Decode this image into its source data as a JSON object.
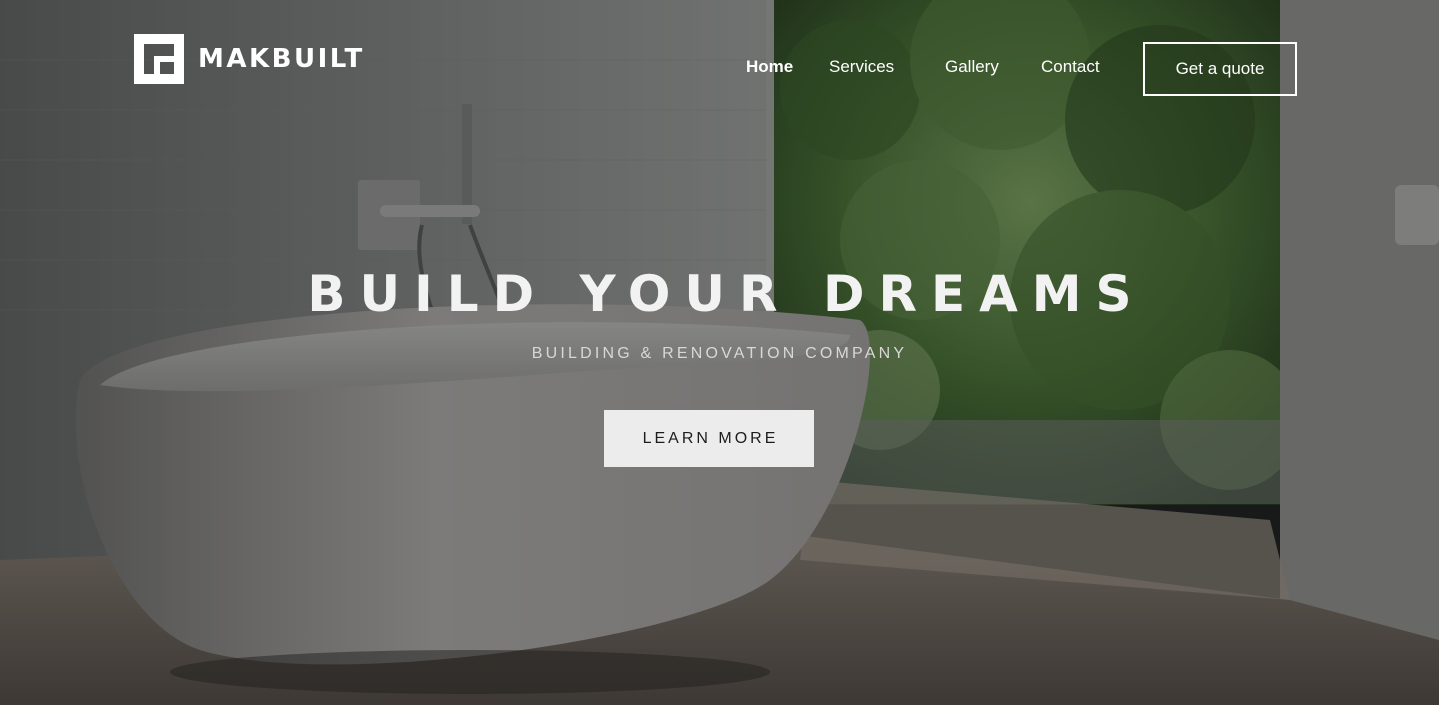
{
  "brand": {
    "name": "MAKBUILT",
    "logo_icon": "makbuilt-logo-icon"
  },
  "nav": {
    "items": [
      {
        "label": "Home",
        "active": true
      },
      {
        "label": "Services",
        "active": false
      },
      {
        "label": "Gallery",
        "active": false
      },
      {
        "label": "Contact",
        "active": false
      }
    ],
    "cta_label": "Get a quote"
  },
  "hero": {
    "title": "BUILD YOUR DREAMS",
    "subtitle": "BUILDING & RENOVATION COMPANY",
    "button_label": "LEARN MORE"
  },
  "colors": {
    "text": "#ffffff",
    "button_bg": "#ececec",
    "button_text": "#1d1d1d",
    "overlay": "#000000"
  }
}
